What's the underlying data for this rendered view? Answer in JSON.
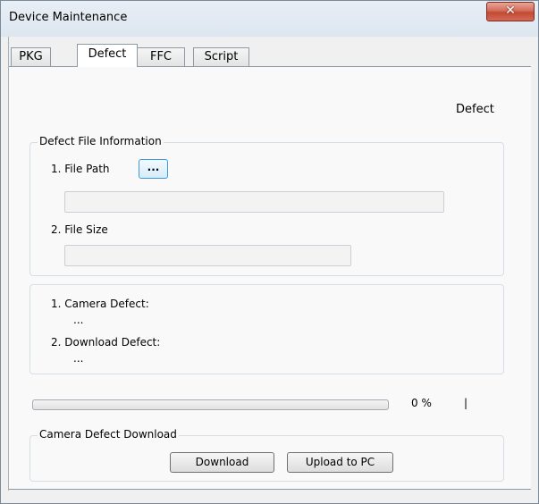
{
  "window": {
    "title": "Device Maintenance",
    "close_glyph": "✕"
  },
  "tabs": [
    {
      "label": "PKG",
      "active": false
    },
    {
      "label": "Defect",
      "active": true
    },
    {
      "label": "FFC",
      "active": false
    },
    {
      "label": "Script",
      "active": false
    }
  ],
  "panel": {
    "right_label": "Defect",
    "file_group": {
      "title": "Defect File Information",
      "file_path_label": "1. File Path",
      "browse_label": "...",
      "file_path_value": "",
      "file_size_label": "2. File Size",
      "file_size_value": ""
    },
    "defect_group": {
      "camera_defect_label": "1. Camera Defect:",
      "camera_defect_value": "...",
      "download_defect_label": "2. Download Defect:",
      "download_defect_value": "..."
    },
    "progress": {
      "percent_text": "0 %",
      "value": 0,
      "marker": "|"
    },
    "download_group": {
      "title": "Camera Defect Download",
      "download_label": "Download",
      "upload_label": "Upload to PC"
    }
  },
  "colors": {
    "progress_fill": "#2db82d",
    "close_button": "#c94d3a",
    "browse_border": "#3c9ad8"
  }
}
